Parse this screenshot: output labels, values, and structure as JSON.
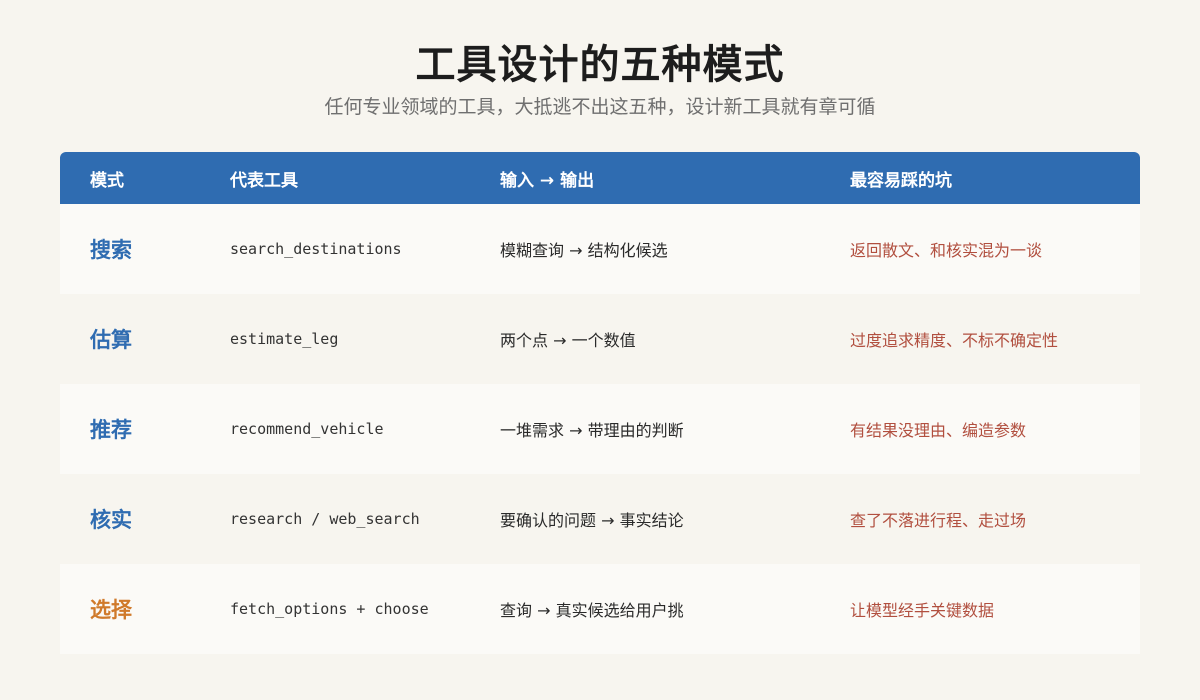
{
  "title": "工具设计的五种模式",
  "subtitle": "任何专业领域的工具，大抵逃不出这五种，设计新工具就有章可循",
  "colors": {
    "header_bg": "#2f6cb1",
    "mode_blue": "#2f6cb1",
    "mode_orange": "#d07a2b",
    "pit_red": "#b14f3f"
  },
  "table": {
    "headers": [
      "模式",
      "代表工具",
      "输入 → 输出",
      "最容易踩的坑"
    ],
    "rows": [
      {
        "mode": "搜索",
        "tool": "search_destinations",
        "io": "模糊查询 → 结构化候选",
        "pit": "返回散文、和核实混为一谈"
      },
      {
        "mode": "估算",
        "tool": "estimate_leg",
        "io": "两个点 → 一个数值",
        "pit": "过度追求精度、不标不确定性"
      },
      {
        "mode": "推荐",
        "tool": "recommend_vehicle",
        "io": "一堆需求 → 带理由的判断",
        "pit": "有结果没理由、编造参数"
      },
      {
        "mode": "核实",
        "tool": "research / web_search",
        "io": "要确认的问题 → 事实结论",
        "pit": "查了不落进行程、走过场"
      },
      {
        "mode": "选择",
        "tool": "fetch_options + choose",
        "io": "查询 → 真实候选给用户挑",
        "pit": "让模型经手关键数据"
      }
    ]
  }
}
